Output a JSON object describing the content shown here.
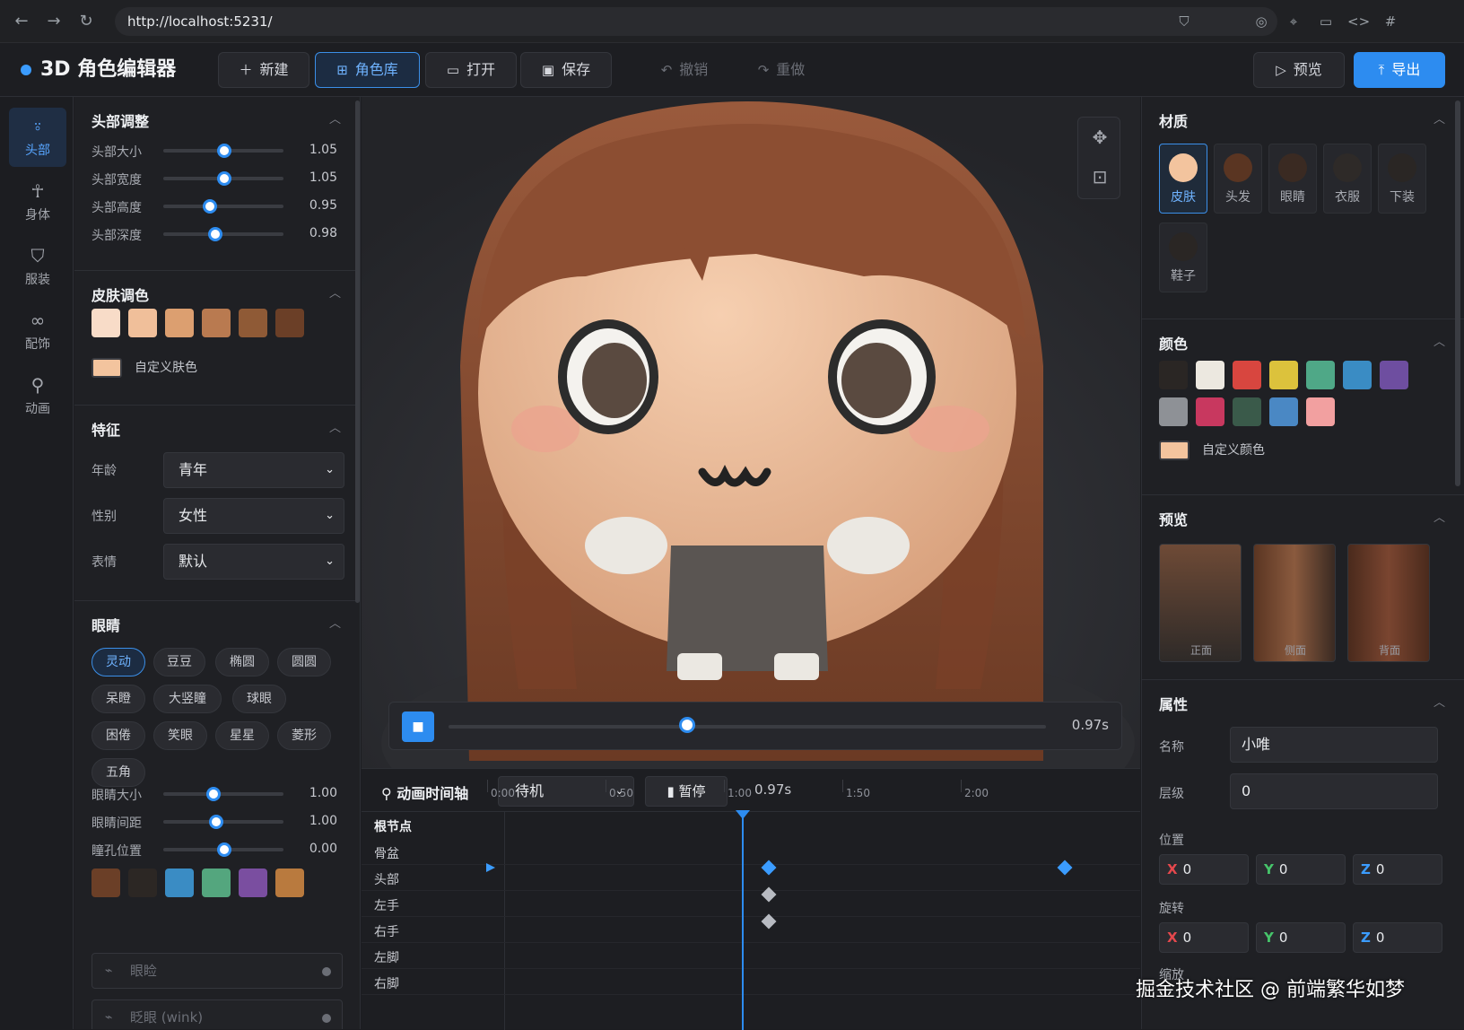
{
  "browser": {
    "url": "http://localhost:5231/"
  },
  "app": {
    "title": "3D 角色编辑器"
  },
  "toolbar": {
    "new": "新建",
    "library": "角色库",
    "open": "打开",
    "save": "保存",
    "undo": "撤销",
    "redo": "重做",
    "preview": "预览",
    "export": "导出"
  },
  "nav": [
    {
      "label": "头部",
      "icon": "user-icon"
    },
    {
      "label": "身体",
      "icon": "figure-icon"
    },
    {
      "label": "服装",
      "icon": "shirt-icon"
    },
    {
      "label": "配饰",
      "icon": "glasses-icon"
    },
    {
      "label": "动画",
      "icon": "running-icon"
    }
  ],
  "head": {
    "title": "头部调整",
    "sliders": [
      {
        "label": "头部大小",
        "value": "1.05",
        "level": 0.51
      },
      {
        "label": "头部宽度",
        "value": "1.05",
        "level": 0.51
      },
      {
        "label": "头部高度",
        "value": "0.95",
        "level": 0.39
      },
      {
        "label": "头部深度",
        "value": "0.98",
        "level": 0.43
      }
    ]
  },
  "skin": {
    "title": "皮肤调色",
    "swatches": [
      "#f8dcc8",
      "#f0bf9a",
      "#dc9f70",
      "#b97a50",
      "#8f5a36",
      "#6b3f27"
    ],
    "custom_label": "自定义肤色",
    "custom_color": "#f3c49e"
  },
  "features": {
    "title": "特征",
    "rows": [
      {
        "label": "年龄",
        "value": "青年"
      },
      {
        "label": "性别",
        "value": "女性"
      },
      {
        "label": "表情",
        "value": "默认"
      }
    ]
  },
  "eyes": {
    "title": "眼睛",
    "chips": [
      "灵动",
      "豆豆",
      "椭圆",
      "圆圆",
      "呆瞪",
      "大竖瞳",
      "球眼",
      "困倦",
      "笑眼",
      "星星",
      "菱形",
      "五角"
    ],
    "sliders": [
      {
        "label": "眼睛大小",
        "value": "1.00",
        "level": 0.42
      },
      {
        "label": "眼睛间距",
        "value": "1.00",
        "level": 0.44
      },
      {
        "label": "瞳孔位置",
        "value": "0.00",
        "level": 0.51
      }
    ],
    "colors": [
      "#6b3f27",
      "#2c2724",
      "#3a8cc4",
      "#54a67e",
      "#7a4ea0",
      "#b97a3e"
    ],
    "toggles": [
      "眼睑",
      "眨眼 (wink)"
    ]
  },
  "player": {
    "time": "0.97s",
    "progress": 0.4
  },
  "timeline": {
    "title": "动画时间轴",
    "clip": "待机",
    "pause": "暂停",
    "time": "0.97s",
    "root": "根节点",
    "ticks": [
      "0:00",
      "0:50",
      "1:00",
      "1:50",
      "2:00"
    ],
    "tracks": [
      "骨盆",
      "头部",
      "左手",
      "右手",
      "左脚",
      "右脚"
    ]
  },
  "material": {
    "title": "材质",
    "items": [
      {
        "label": "皮肤",
        "color": "#f3c49e"
      },
      {
        "label": "头发",
        "color": "#5a3522"
      },
      {
        "label": "眼睛",
        "color": "#3a2a22"
      },
      {
        "label": "衣服",
        "color": "#2e2a28"
      },
      {
        "label": "下装",
        "color": "#2a2624"
      },
      {
        "label": "鞋子",
        "color": "#2a2624"
      }
    ]
  },
  "color": {
    "title": "颜色",
    "swatches": [
      "#2a2624",
      "#ece8e0",
      "#d8463f",
      "#dcc23c",
      "#4fa887",
      "#3a8cc4",
      "#6e4ea0",
      "#8e9196",
      "#c8385f",
      "#3a5a4a",
      "#4a88c4",
      "#f2a0a0"
    ],
    "custom_label": "自定义颜色",
    "custom_color": "#f3c49e"
  },
  "preview": {
    "title": "预览",
    "views": [
      "正面",
      "侧面",
      "背面"
    ]
  },
  "props": {
    "title": "属性",
    "name_label": "名称",
    "name_value": "小唯",
    "layer_label": "层级",
    "layer_value": "0",
    "pos_label": "位置",
    "rot_label": "旋转",
    "scale_label": "缩放",
    "pos": [
      "0",
      "0",
      "0"
    ],
    "rot": [
      "0",
      "0",
      "0"
    ]
  },
  "watermark": "掘金技术社区 @ 前端繁华如梦"
}
